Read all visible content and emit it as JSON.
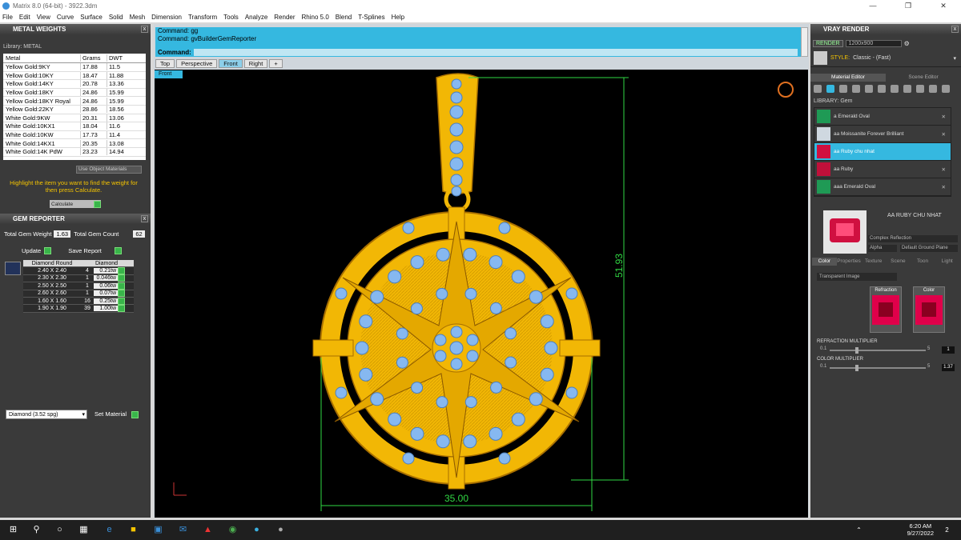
{
  "window": {
    "title": "Matrix 8.0 (64-bit) - 3922.3dm"
  },
  "menu": [
    "File",
    "Edit",
    "View",
    "Curve",
    "Surface",
    "Solid",
    "Mesh",
    "Dimension",
    "Transform",
    "Tools",
    "Analyze",
    "Render",
    "Rhino 5.0",
    "Blend",
    "T-Splines",
    "Help"
  ],
  "metal": {
    "title": "METAL WEIGHTS",
    "library_label": "Library: METAL",
    "headers": [
      "Metal",
      "Grams",
      "DWT"
    ],
    "rows": [
      [
        "Yellow Gold:9KY",
        "17.88",
        "11.5"
      ],
      [
        "Yellow Gold:10KY",
        "18.47",
        "11.88"
      ],
      [
        "Yellow Gold:14KY",
        "20.78",
        "13.36"
      ],
      [
        "Yellow Gold:18KY",
        "24.86",
        "15.99"
      ],
      [
        "Yellow Gold:18KY Royal",
        "24.86",
        "15.99"
      ],
      [
        "Yellow Gold:22KY",
        "28.86",
        "18.56"
      ],
      [
        "White Gold:9KW",
        "20.31",
        "13.06"
      ],
      [
        "White Gold:10KX1",
        "18.04",
        "11.6"
      ],
      [
        "White Gold:10KW",
        "17.73",
        "11.4"
      ],
      [
        "White Gold:14KX1",
        "20.35",
        "13.08"
      ],
      [
        "White Gold:14K PdW",
        "23.23",
        "14.94"
      ]
    ],
    "use_object_materials": "Use Object Materials",
    "hint": "Highlight the item you want to find the weight for then press Calculate.",
    "calculate": "Calculate"
  },
  "gem": {
    "title": "GEM REPORTER",
    "total_weight_label": "Total Gem Weight",
    "total_weight": "1.63",
    "total_count_label": "Total Gem Count",
    "total_count": "62",
    "update": "Update",
    "save_report": "Save Report",
    "headers": [
      "Diamond Round",
      "Diamond"
    ],
    "rows": [
      [
        "2.40 X 2.40",
        "4",
        "0.21tw"
      ],
      [
        "2.30 X 2.30",
        "1",
        "0.046tw"
      ],
      [
        "2.50 X 2.50",
        "1",
        "0.06tw"
      ],
      [
        "2.60 X 2.60",
        "1",
        "0.07tw"
      ],
      [
        "1.60 X 1.60",
        "16",
        "0.25tw"
      ],
      [
        "1.90 X 1.90",
        "39",
        "1.00tw"
      ]
    ],
    "material_select": "Diamond     (3.52 spg)",
    "set_material": "Set Material"
  },
  "command": {
    "history": [
      "Command: gg",
      "Command: gvBuilderGemReporter"
    ],
    "prompt": "Command:"
  },
  "viewport_tabs": [
    "Top",
    "Perspective",
    "Front",
    "Right",
    "+"
  ],
  "active_tab": "Front",
  "viewport_label": "Front",
  "dimensions": {
    "height": "51.93",
    "width": "35.00"
  },
  "vray": {
    "title": "VRAY RENDER",
    "render": "RENDER",
    "resolution": "1200x900",
    "style_label": "STYLE:",
    "style_value": "Classic - (Fast)",
    "tabs": [
      "Material Editor",
      "Scene Editor"
    ],
    "library": "LIBRARY: Gem",
    "materials": [
      "a Emerald Oval",
      "aa Moissanite Forever Brilliant",
      "aa Ruby chu nhat",
      "aa Ruby",
      "aaa Emerald Oval"
    ],
    "selected_material": "AA RUBY CHU NHAT",
    "prop1": "Complex Reflection",
    "prop2": "Alpha",
    "prop3": "Default Ground Plane",
    "prop_tabs": [
      "Color",
      "Properties",
      "Texture",
      "Scene",
      "Toon",
      "Light"
    ],
    "map_select": "Transparent Image",
    "swatch1": "Refraction",
    "swatch2": "Color",
    "refraction_mult_label": "REFRACTION MULTIPLIER",
    "refraction_mult": "1",
    "color_mult_label": "COLOR MULTIPLIER",
    "color_mult": "1.37",
    "slider_min": "0.1",
    "slider_max": "5"
  },
  "taskbar": {
    "time": "6:20 AM",
    "date": "9/27/2022",
    "notif": "2"
  }
}
